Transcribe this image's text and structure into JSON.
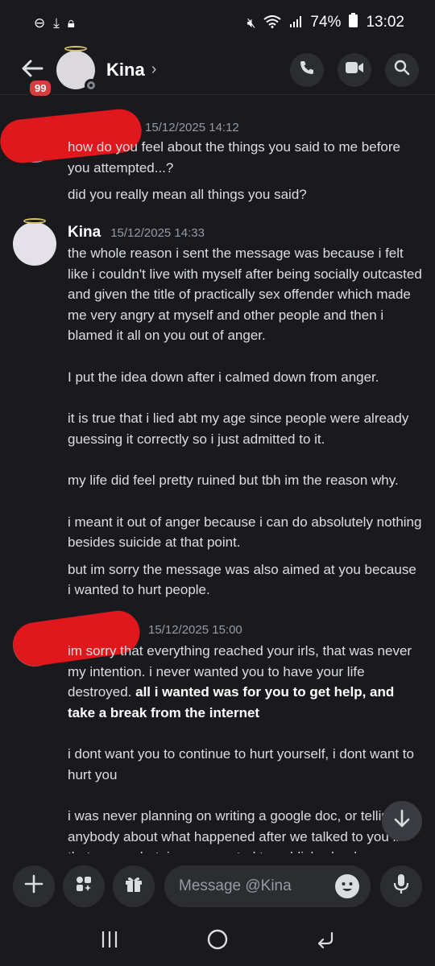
{
  "status_bar": {
    "battery": "74%",
    "time": "13:02"
  },
  "header": {
    "back_badge": "99",
    "name": "Kina",
    "chevron": "›"
  },
  "messages": [
    {
      "author": "",
      "time": "15/12/2025 14:12",
      "paragraphs": [
        "how do you feel about the things you said to me before you attempted...?",
        "did you really mean all things you said?"
      ]
    },
    {
      "author": "Kina",
      "time": "15/12/2025 14:33",
      "paragraphs": [
        "the whole reason i sent the message was because i felt like i couldn't live with myself after being socially outcasted and given the title of practically sex offender which made me very angry at myself and other people and then i blamed it all on you out of anger.",
        "I put the idea down after i calmed down from anger.",
        "it is true that i lied abt my age since people were already guessing it correctly so i just admitted to it.",
        "my life did feel pretty ruined but tbh im the reason why.",
        "i meant it out of anger because i can do absolutely nothing besides suicide at that point.",
        "but im sorry the message was also aimed at you because i wanted to hurt people."
      ]
    },
    {
      "author": "",
      "time": "15/12/2025 15:00",
      "p1_normal": "im sorry that everything reached your irls, that was never my intention. i never wanted you to have your life destroyed. ",
      "p1_bold": "all i wanted was for you to get help, and take a break from the internet",
      "p2": "i dont want you to continue to hurt yourself, i dont want to hurt you",
      "p3": "i was never planning on writing a google doc, or telling anybody about what happened after we talked to you in that group chat, i never wanted to publicly slander you"
    }
  ],
  "composer": {
    "placeholder": "Message @Kina"
  },
  "icons": {
    "back": "arrow-left-icon",
    "call": "phone-icon",
    "video": "video-camera-icon",
    "search": "search-icon",
    "add": "plus-icon",
    "apps": "apps-icon",
    "gift": "gift-icon",
    "emoji": "emoji-icon",
    "mic": "microphone-icon",
    "scroll": "arrow-down-icon"
  },
  "colors": {
    "background": "#1a1a1e",
    "surface": "#2b2d31",
    "redaction": "#e0171c",
    "badge": "#d83c3e"
  }
}
